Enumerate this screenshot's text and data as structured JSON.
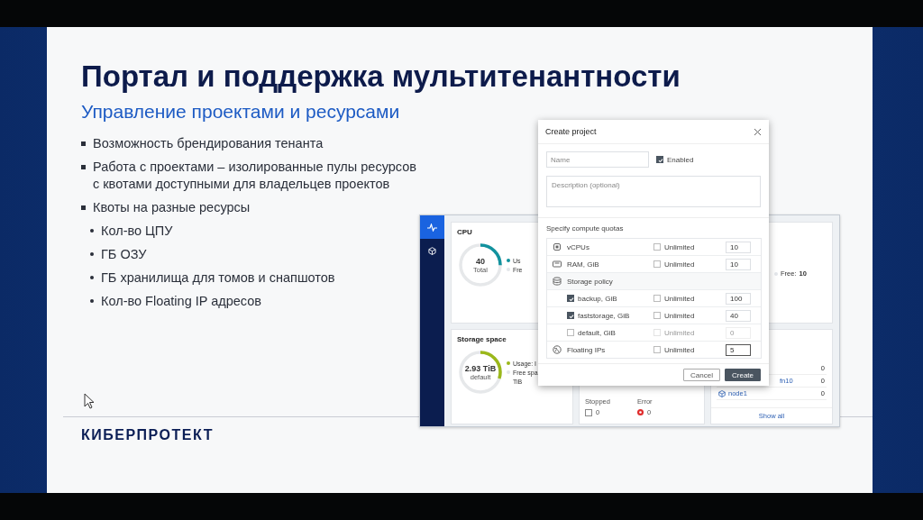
{
  "slide": {
    "title": "Портал и поддержка мультитенантности",
    "subtitle": "Управление проектами и ресурсами",
    "bullets": [
      {
        "text": "Возможность брендирования тенанта"
      },
      {
        "text": "Работа с проектами – изолированные пулы ресурсов с квотами доступными для владельцев проектов"
      },
      {
        "text": "Квоты на разные ресурсы",
        "children": [
          {
            "text": "Кол-во ЦПУ"
          },
          {
            "text": "ГБ ОЗУ"
          },
          {
            "text": "ГБ хранилища для томов и снапшотов"
          },
          {
            "text": "Кол-во Floating IP адресов"
          }
        ]
      }
    ],
    "logo": "КИБЕРПРОТЕКТ"
  },
  "app": {
    "sidebar": [
      {
        "selected": true
      },
      {
        "selected": false
      }
    ],
    "cpu_card": {
      "title": "CPU",
      "value": "40",
      "caption": "Total",
      "level": 0.25,
      "legend": [
        {
          "text": "Us",
          "color": "#12929e"
        },
        {
          "text": "Fre",
          "color": "#e3e6ea"
        }
      ]
    },
    "storage_card": {
      "title": "Storage space",
      "value": "2.93 TiB",
      "caption": "default",
      "level": 0.3,
      "legend": [
        {
          "text": "Usage: I",
          "color": "#9bb81a"
        },
        {
          "text": "Free spa",
          "color": "#e3e6ea"
        }
      ],
      "legend_extra": "TiB"
    },
    "limits_card": {
      "label": "Free:",
      "value": "10"
    },
    "vm_status": [
      {
        "kind": "stopped",
        "label": "Stopped",
        "value": "0"
      },
      {
        "kind": "error",
        "label": "Error",
        "value": "0"
      }
    ],
    "nodes": {
      "rows": [
        {
          "kind": "item",
          "value": "0"
        },
        {
          "kind": "item",
          "name": "fn10",
          "value": "0"
        },
        {
          "kind": "node",
          "name": "node1",
          "value": "0"
        }
      ],
      "link": "Show all"
    }
  },
  "dialog": {
    "title": "Create project",
    "name_placeholder": "Name",
    "enabled": {
      "label": "Enabled",
      "checked": true
    },
    "description_placeholder": "Description (optional)",
    "quotas_label": "Specify compute quotas",
    "quotas": [
      {
        "kind": "resource",
        "label": "vCPUs",
        "unlimited": {
          "label": "Unlimited",
          "checked": false
        },
        "value": "10",
        "focused": false
      },
      {
        "kind": "resource",
        "label": "RAM, GiB",
        "unlimited": {
          "label": "Unlimited",
          "checked": false
        },
        "value": "10",
        "focused": false
      },
      {
        "kind": "group",
        "label": "Storage policy"
      },
      {
        "kind": "policy",
        "label": "backup, GiB",
        "checked": true,
        "disabled": false,
        "unlimited": {
          "label": "Unlimited",
          "checked": false
        },
        "value": "100",
        "focused": false
      },
      {
        "kind": "policy",
        "label": "faststorage, GiB",
        "checked": true,
        "disabled": false,
        "unlimited": {
          "label": "Unlimited",
          "checked": false
        },
        "value": "40",
        "focused": false
      },
      {
        "kind": "policy",
        "label": "default, GiB",
        "checked": false,
        "disabled": true,
        "unlimited": {
          "label": "Unlimited",
          "checked": false
        },
        "value": "0",
        "focused": false
      },
      {
        "kind": "resource",
        "label": "Floating IPs",
        "unlimited": {
          "label": "Unlimited",
          "checked": false
        },
        "value": "5",
        "focused": true
      }
    ],
    "buttons": [
      {
        "kind": "secondary",
        "label": "Cancel"
      },
      {
        "kind": "primary",
        "label": "Create"
      }
    ]
  }
}
